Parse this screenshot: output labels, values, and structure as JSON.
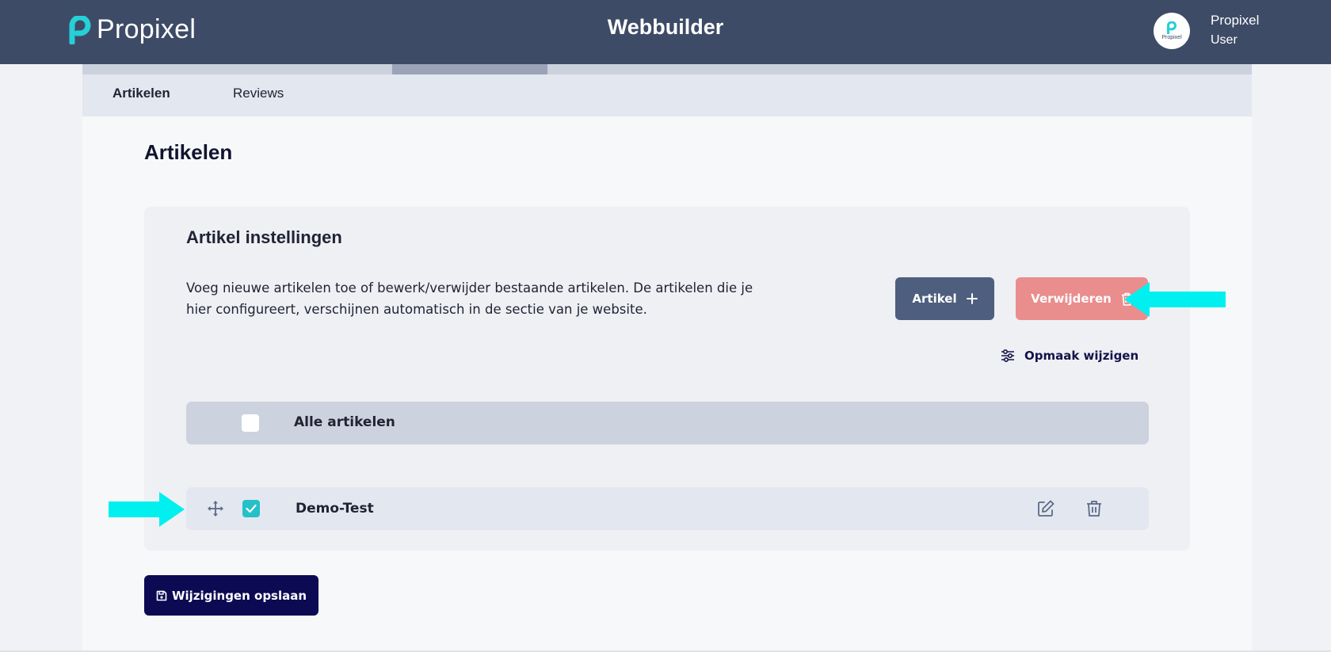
{
  "header": {
    "logo_text": "Propixel",
    "app_title": "Webbuilder",
    "avatar_label": "Propixel",
    "user_name": "Propixel",
    "user_role": "User"
  },
  "progress": {
    "fraction": 0.133
  },
  "tabs": [
    {
      "label": "Artikelen",
      "active": true
    },
    {
      "label": "Reviews",
      "active": false
    }
  ],
  "page_title": "Artikelen",
  "card": {
    "title": "Artikel instellingen",
    "description": "Voeg nieuwe artikelen toe of bewerk/verwijder bestaande artikelen. De artikelen die je hier configureert, verschijnen automatisch in de sectie van je website.",
    "add_button": "Artikel",
    "delete_button": "Verwijderen",
    "format_link": "Opmaak wijzigen",
    "select_all_label": "Alle artikelen",
    "items": [
      {
        "label": "Demo-Test",
        "checked": true
      }
    ]
  },
  "save_button": "Wijzigingen opslaan",
  "colors": {
    "topbar": "#3e4b66",
    "accent": "#25c0c8",
    "delete": "#ea8d8d",
    "save": "#0b0a52",
    "annotation_arrow": "#00f0f0"
  },
  "icons": {
    "add": "plus-icon",
    "delete": "trash-icon",
    "format": "sliders-icon",
    "drag": "move-icon",
    "edit": "edit-icon",
    "save": "floppy-disk-icon"
  }
}
